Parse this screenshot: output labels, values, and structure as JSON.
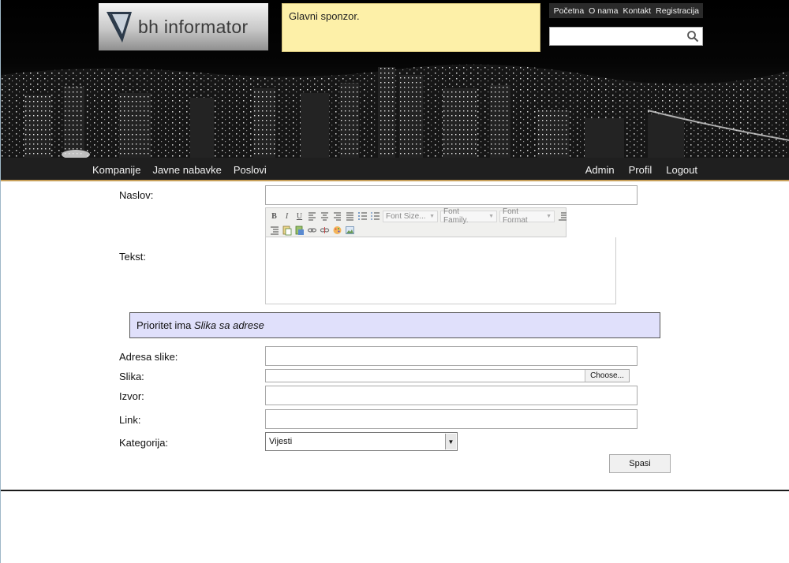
{
  "header": {
    "logo_text": "bh informator",
    "sponsor_text": "Glavni sponzor.",
    "top_links": [
      "Početna",
      "O nama",
      "Kontakt",
      "Registracija"
    ],
    "search": {
      "value": "",
      "placeholder": ""
    }
  },
  "nav": {
    "left": [
      "Kompanije",
      "Javne nabavke",
      "Poslovi"
    ],
    "right": [
      "Admin",
      "Profil",
      "Logout"
    ]
  },
  "form": {
    "naslov_label": "Naslov:",
    "tekst_label": "Tekst:",
    "toolbar": {
      "font_size": "Font Size...",
      "font_family": "Font Family.",
      "font_format": "Font Format"
    },
    "priority_prefix": "Prioritet ima ",
    "priority_emphasis": "Slika sa adrese",
    "adresa_label": "Adresa slike:",
    "slika_label": "Slika:",
    "choose_label": "Choose...",
    "izvor_label": "Izvor:",
    "link_label": "Link:",
    "kategorija_label": "Kategorija:",
    "kategorija_value": "Vijesti",
    "save_label": "Spasi"
  },
  "colors": {
    "sponsor_bg": "#fdf0a8",
    "priority_bg": "#e0e0fb",
    "nav_bg": "#1f1f1f",
    "nav_accent": "#c8a05a"
  }
}
